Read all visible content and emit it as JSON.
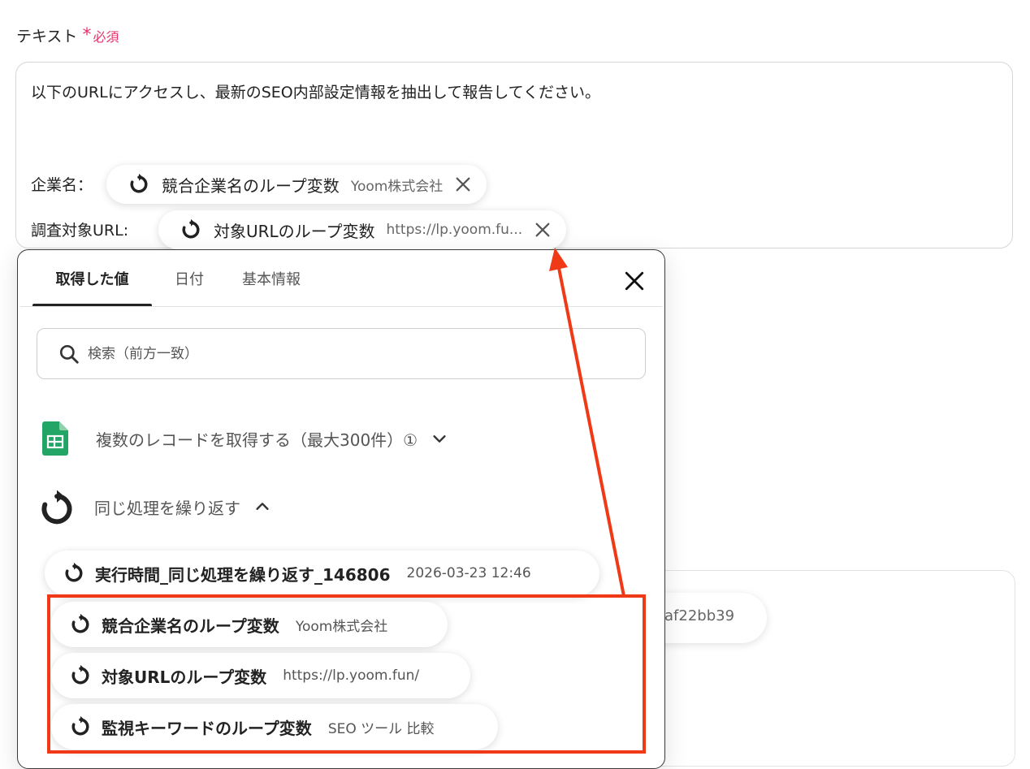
{
  "field": {
    "label": "テキスト",
    "required_star": "*",
    "required_text": "必須"
  },
  "textarea": {
    "line1": "以下のURLにアクセスし、最新のSEO内部設定情報を抽出して報告してください。",
    "company_label": "企業名：",
    "url_label": "調査対象URL:"
  },
  "inline_chips": [
    {
      "label": "競合企業名のループ変数",
      "value": "Yoom株式会社"
    },
    {
      "label": "対象URLのループ変数",
      "value": "https://lp.yoom.fu..."
    }
  ],
  "background_chip": {
    "value": "af22bb39"
  },
  "popup": {
    "tabs": [
      {
        "label": "取得した値",
        "active": true
      },
      {
        "label": "日付",
        "active": false
      },
      {
        "label": "基本情報",
        "active": false
      }
    ],
    "search": {
      "placeholder": "検索（前方一致）"
    },
    "sections": [
      {
        "title": "複数のレコードを取得する（最大300件）①",
        "icon": "google-sheets-icon",
        "expanded": false
      },
      {
        "title": "同じ処理を繰り返す",
        "icon": "loop-icon",
        "expanded": true
      }
    ],
    "items": [
      {
        "label": "実行時間_同じ処理を繰り返す_146806",
        "value": "2026-03-23 12:46"
      },
      {
        "label": "競合企業名のループ変数",
        "value": "Yoom株式会社"
      },
      {
        "label": "対象URLのループ変数",
        "value": "https://lp.yoom.fun/"
      },
      {
        "label": "監視キーワードのループ変数",
        "value": "SEO ツール 比較"
      }
    ]
  },
  "colors": {
    "required": "#e5326a",
    "annotation": "#f03a17",
    "sheets_green": "#23a566"
  }
}
